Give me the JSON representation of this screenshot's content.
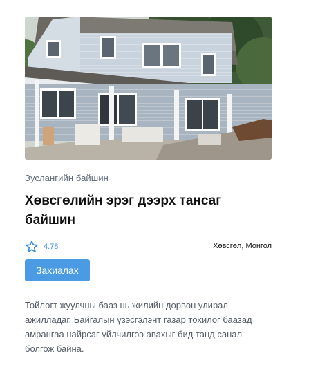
{
  "card": {
    "category": "Зуслангийн байшин",
    "title": "Хөвсгөлийн эрэг дээрх тансаг байшин",
    "rating": "4.78",
    "location": "Хөвсгөл, Монгол",
    "book_label": "Захиалах",
    "description": "Тойлогт жуулчны бааз нь жилийн дөрвөн улирал ажилладаг. Байгалын үзэсгэлэнт газар тохилог баазад амрангаа найрсаг үйлчилгээ авахыг бид танд санал болгож байна."
  },
  "colors": {
    "accent": "#4a9be3",
    "rating_text": "#3b8ede",
    "category_text": "#5f6b7a"
  },
  "icons": {
    "rating": "star-outline-icon"
  }
}
